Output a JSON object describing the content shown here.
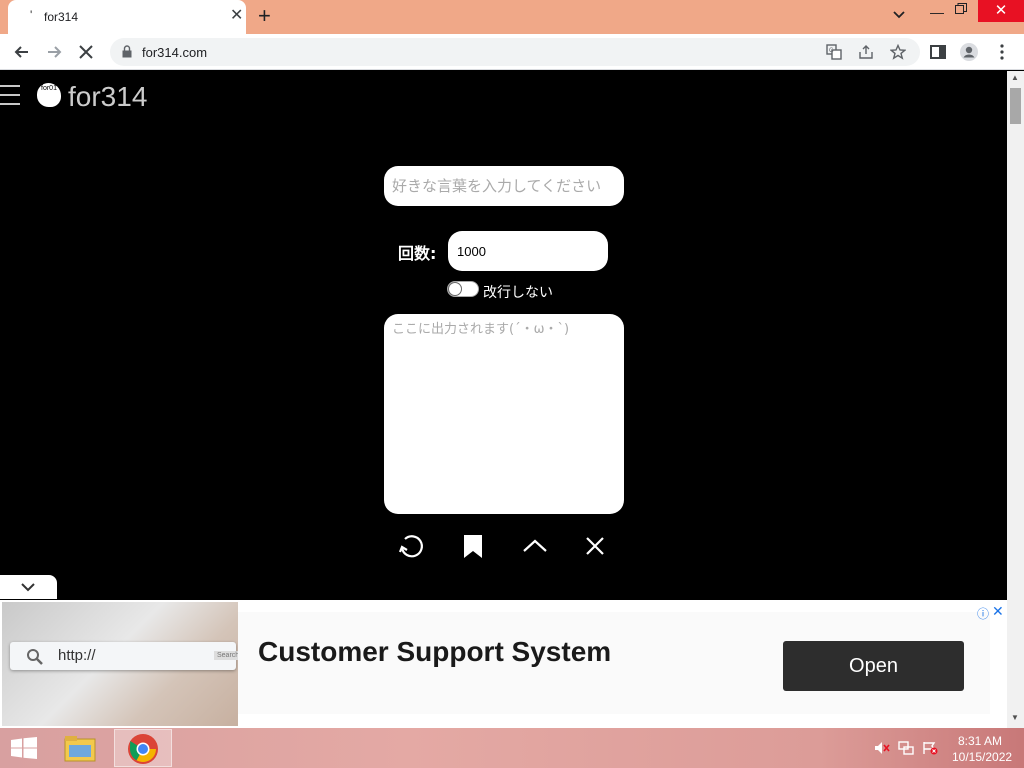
{
  "browser": {
    "tab_title": "for314",
    "tab_favicon": "'",
    "url": "for314.com",
    "colors": {
      "tabstrip": "#f0a888",
      "close_button": "#e81123"
    }
  },
  "page": {
    "site_title": "for314",
    "logo_text": "for01",
    "word_input_placeholder": "好きな言葉を入力してください",
    "count_label": "回数:",
    "count_value": "1000",
    "toggle_label": "改行しない",
    "toggle_on": false,
    "output_placeholder": "ここに出力されます(´・ω・`)",
    "actions": [
      "refresh-icon",
      "bookmark-icon",
      "chevron-up-icon",
      "close-icon"
    ]
  },
  "ad": {
    "image_text": "http://",
    "image_button": "Search",
    "headline": "Customer Support System",
    "button_label": "Open",
    "info_icon": "ⓘ",
    "close_icon": "✕"
  },
  "taskbar": {
    "time": "8:31 AM",
    "date": "10/15/2022",
    "apps": [
      "file-explorer",
      "chrome"
    ]
  }
}
